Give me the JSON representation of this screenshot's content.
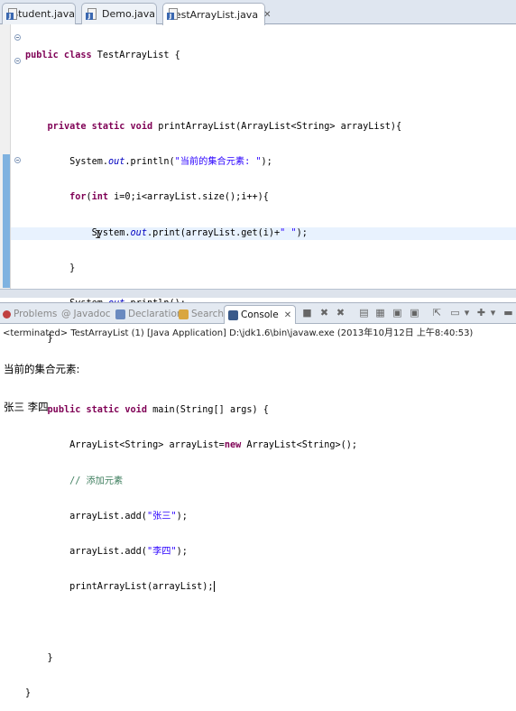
{
  "editor_tabs": [
    {
      "label": "Student.java"
    },
    {
      "label": "Demo.java"
    },
    {
      "label": "TestArrayList.java",
      "active": true,
      "close": "✕"
    }
  ],
  "code": {
    "l1_kw": "public class",
    "l1_rest": " TestArrayList {",
    "l2_kw": "private static void",
    "l2_rest": " printArrayList(ArrayList<String> arrayList){",
    "l3_a": "System.",
    "l3_out": "out",
    "l3_b": ".println(",
    "l3_str": "\"当前的集合元素: \"",
    "l3_c": ");",
    "l4_kw": "for",
    "l4_a": "(",
    "l4_kw2": "int",
    "l4_b": " i=0;i<arrayList.size();i++){",
    "l5_a": "System.",
    "l5_out": "out",
    "l5_b": ".print(arrayList.get(i)+",
    "l5_str": "\" \"",
    "l5_c": ");",
    "l6": "}",
    "l7_a": "System.",
    "l7_out": "out",
    "l7_b": ".println();",
    "l8": "}",
    "l9_kw": "public static void",
    "l9_rest": " main(String[] args) {",
    "l10_a": "ArrayList<String> arrayList=",
    "l10_kw": "new",
    "l10_b": " ArrayList<String>();",
    "l11_cm": "// 添加元素",
    "l12_a": "arrayList.add(",
    "l12_str": "\"张三\"",
    "l12_b": ");",
    "l13_a": "arrayList.add(",
    "l13_str": "\"李四\"",
    "l13_b": ");",
    "l14": "printArrayList(arrayList);",
    "l16": "}",
    "l17": "}"
  },
  "console_tabs": [
    {
      "label": "Problems",
      "icon": "problems-icon",
      "color": "#c04040"
    },
    {
      "label": "Javadoc",
      "icon": "at-icon"
    },
    {
      "label": "Declaration",
      "icon": "declaration-icon",
      "color": "#6a8ac0"
    },
    {
      "label": "Search",
      "icon": "search-icon",
      "color": "#d9a640"
    },
    {
      "label": "Console",
      "icon": "console-icon",
      "color": "#3a5a8a",
      "active": true,
      "close": "✕"
    }
  ],
  "terminated_text": "<terminated> TestArrayList (1) [Java Application] D:\\jdk1.6\\bin\\javaw.exe (2013年10月12日 上午8:40:53)",
  "output_lines": [
    "当前的集合元素:",
    "张三 李四"
  ]
}
